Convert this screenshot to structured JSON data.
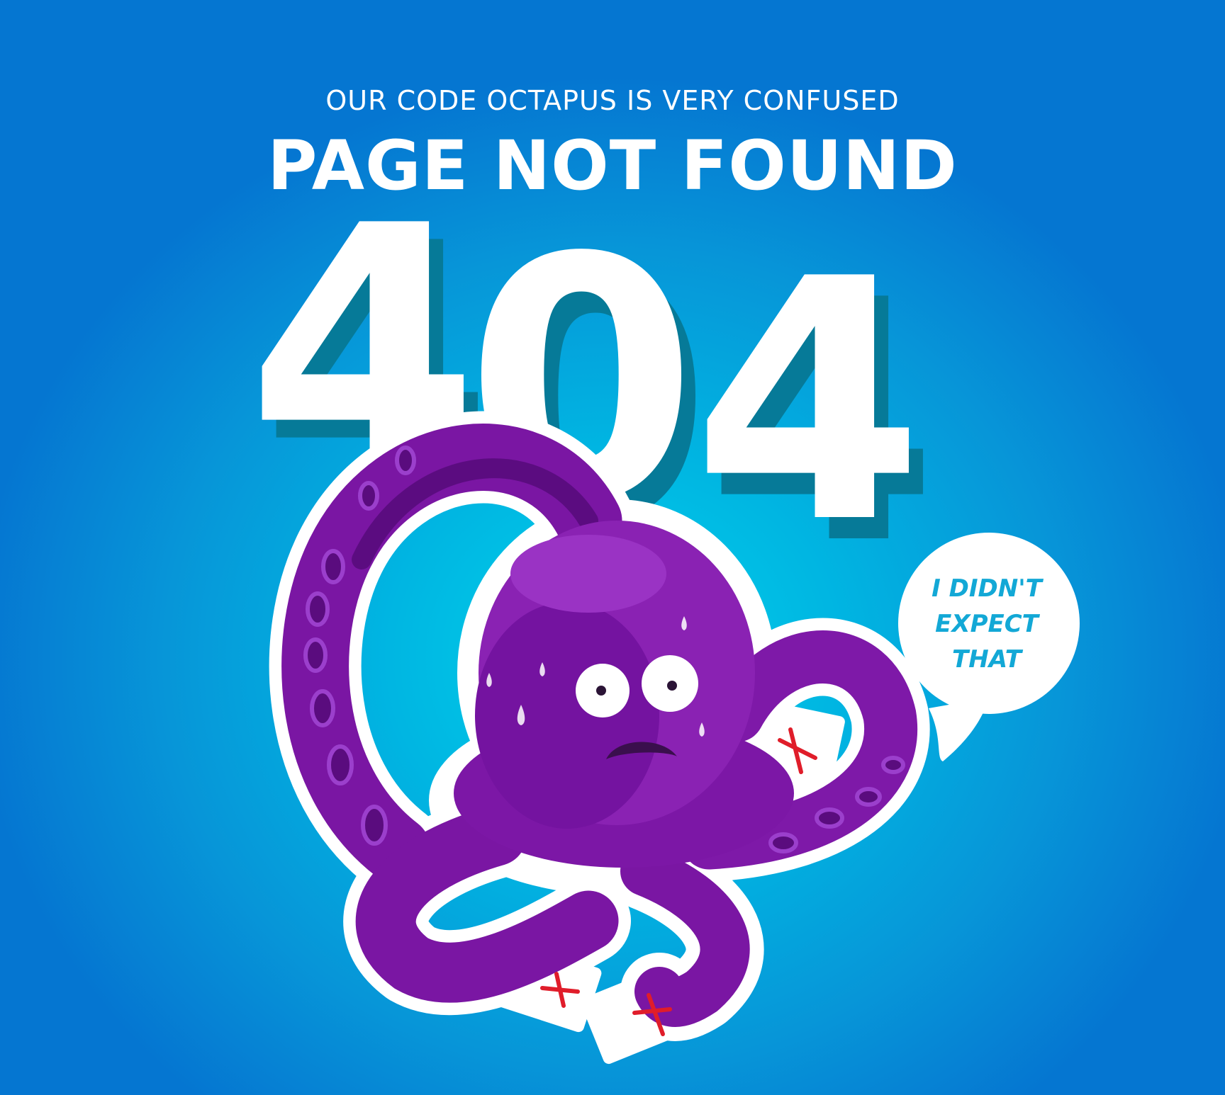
{
  "header": {
    "subtitle": "OUR CODE OCTAPUS IS VERY CONFUSED",
    "title": "PAGE NOT FOUND"
  },
  "error_code": {
    "digit_1": "4",
    "digit_2": "0",
    "digit_3": "4"
  },
  "speech_bubble": {
    "line_1": "I DIDN'T",
    "line_2": "EXPECT",
    "line_3": "THAT"
  },
  "colors": {
    "background_center": "#00d2ea",
    "background_edge": "#0576d1",
    "octopus": "#7b17a6",
    "digit_shadow": "#067a98",
    "bubble_text": "#13a8d6",
    "x_mark": "#e01d2a"
  },
  "icons": [
    "octopus-illustration",
    "speech-bubble",
    "sweat-drop-icon",
    "x-mark-icon"
  ]
}
